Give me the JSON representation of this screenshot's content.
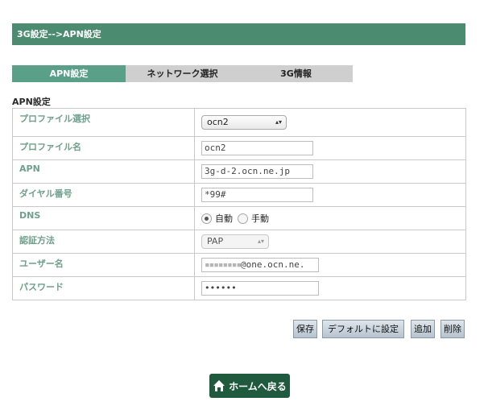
{
  "header": {
    "title": "3G設定-->APN設定"
  },
  "tabs": [
    {
      "label": "APN設定",
      "active": true
    },
    {
      "label": "ネットワーク選択",
      "active": false
    },
    {
      "label": "3G情報",
      "active": false
    }
  ],
  "section": {
    "title": "APN設定"
  },
  "form": {
    "profile_select": {
      "label": "プロファイル選択",
      "value": "ocn2"
    },
    "profile_name": {
      "label": "プロファイル名",
      "value": "ocn2"
    },
    "apn": {
      "label": "APN",
      "value": "3g-d-2.ocn.ne.jp"
    },
    "dial_number": {
      "label": "ダイヤル番号",
      "value": "*99#"
    },
    "dns": {
      "label": "DNS",
      "options": [
        "自動",
        "手動"
      ],
      "selected": "自動"
    },
    "auth": {
      "label": "認証方法",
      "value": "PAP"
    },
    "username": {
      "label": "ユーザー名",
      "value_suffix": "@one.ocn.ne."
    },
    "password": {
      "label": "パスワード",
      "value": "••••••"
    }
  },
  "buttons": {
    "save": "保存",
    "set_default": "デフォルトに設定",
    "add": "追加",
    "delete": "削除"
  },
  "home_button": {
    "label": "ホームへ戻る",
    "icon": "home-icon"
  },
  "colors": {
    "header_bg": "#4b8b6f",
    "tab_active": "#5aa088",
    "label_text": "#6ea08a",
    "home_button_bg": "#1f5a3e"
  }
}
